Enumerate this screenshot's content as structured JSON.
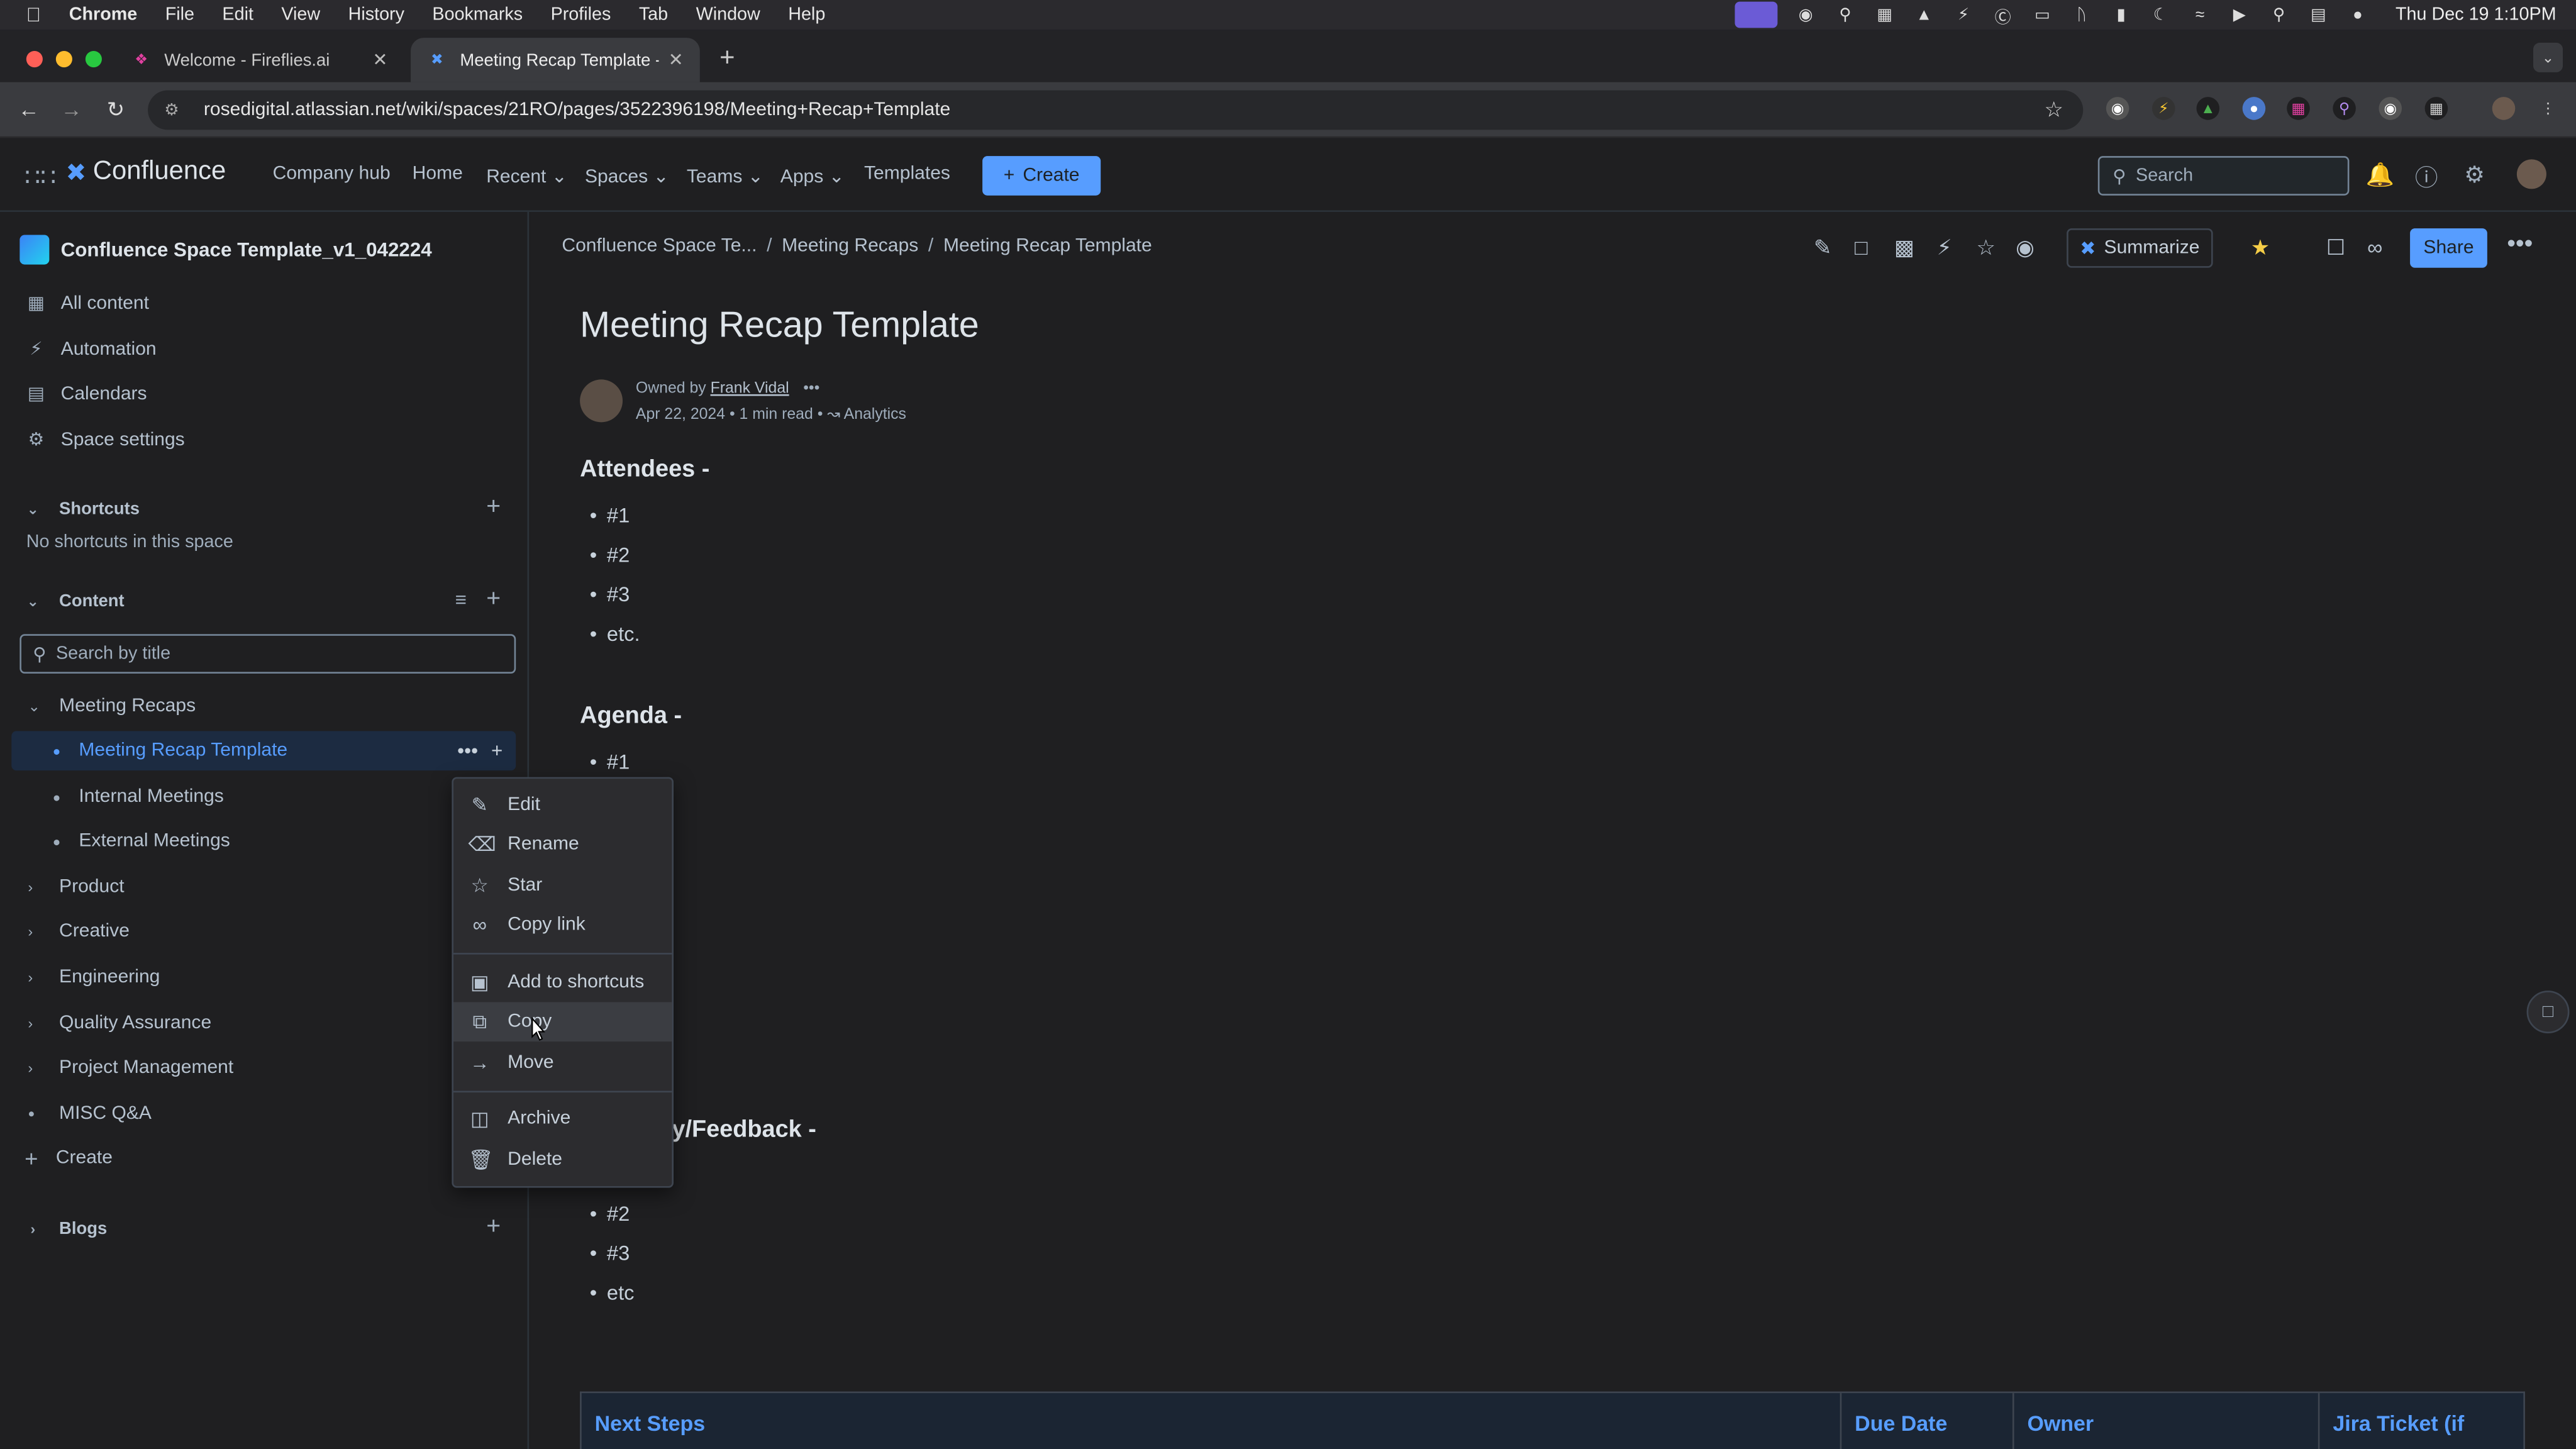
{
  "menubar": {
    "app": "Chrome",
    "items": [
      "File",
      "Edit",
      "View",
      "History",
      "Bookmarks",
      "Profiles",
      "Tab",
      "Window",
      "Help"
    ],
    "clock": "Thu Dec 19  1:10PM"
  },
  "browser": {
    "tabs": [
      {
        "title": "Welcome - Fireflies.ai",
        "favicon": "fireflies-icon"
      },
      {
        "title": "Meeting Recap Template - Con",
        "favicon": "confluence-icon"
      }
    ],
    "url": "rosedigital.atlassian.net/wiki/spaces/21RO/pages/3522396198/Meeting+Recap+Template"
  },
  "header": {
    "brand": "Confluence",
    "nav": [
      "Company hub",
      "Home",
      "Recent",
      "Spaces",
      "Teams",
      "Apps",
      "Templates"
    ],
    "create_label": "Create",
    "search_placeholder": "Search"
  },
  "sidebar": {
    "space_title": "Confluence Space Template_v1_042224",
    "nav": [
      {
        "label": "All content",
        "icon": "all-content-icon"
      },
      {
        "label": "Automation",
        "icon": "lightning-icon"
      },
      {
        "label": "Calendars",
        "icon": "calendar-icon"
      },
      {
        "label": "Space settings",
        "icon": "gear-icon"
      }
    ],
    "shortcuts_title": "Shortcuts",
    "shortcuts_empty": "No shortcuts in this space",
    "content_title": "Content",
    "title_search_placeholder": "Search by title",
    "tree": {
      "meeting_recaps": "Meeting Recaps",
      "meeting_recap_template": "Meeting Recap Template",
      "internal_meetings": "Internal Meetings",
      "external_meetings": "External Meetings",
      "product": "Product",
      "creative": "Creative",
      "engineering": "Engineering",
      "quality_assurance": "Quality Assurance",
      "project_management": "Project Management",
      "misc_qa": "MISC Q&A",
      "create": "Create"
    },
    "blogs_title": "Blogs"
  },
  "context_menu": {
    "edit": "Edit",
    "rename": "Rename",
    "star": "Star",
    "copy_link": "Copy link",
    "add_to_shortcuts": "Add to shortcuts",
    "copy": "Copy",
    "move": "Move",
    "archive": "Archive",
    "delete": "Delete"
  },
  "page": {
    "breadcrumbs": [
      "Confluence Space Te...",
      "Meeting Recaps",
      "Meeting Recap Template"
    ],
    "summarize_label": "Summarize",
    "share_label": "Share",
    "title": "Meeting Recap Template",
    "owned_by_prefix": "Owned by",
    "owner": "Frank Vidal",
    "date": "Apr 22, 2024",
    "read_time": "1 min read",
    "analytics": "Analytics",
    "attendees_heading": "Attendees -",
    "attendees": [
      "#1",
      "#2",
      "#3",
      "etc."
    ],
    "agenda_heading": "Agenda -",
    "agenda_first": "#1",
    "feedback_heading_visible": "y/Feedback -",
    "feedback_items": [
      "#2",
      "#3",
      "etc"
    ],
    "table_headers": [
      "Next Steps",
      "Due Date",
      "Owner",
      "Jira Ticket (if"
    ]
  }
}
